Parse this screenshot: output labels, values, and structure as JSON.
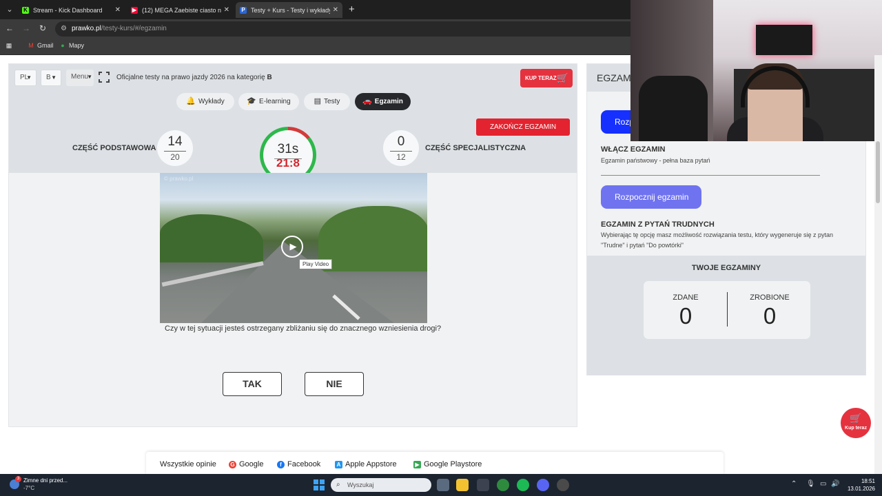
{
  "browser": {
    "tabs": [
      {
        "title": "Stream - Kick Dashboard",
        "favicon": "kick-icon",
        "active": false
      },
      {
        "title": "(12) MEGA Zaebiste ciasto na P",
        "favicon": "youtube-icon",
        "active": false
      },
      {
        "title": "Testy + Kurs - Testy i wykłady n",
        "favicon": "prawko-icon",
        "active": true
      }
    ],
    "url_host": "prawko.pl",
    "url_path": "/testy-kurs/#/egzamin",
    "bookmarks": [
      {
        "label": "Gmail",
        "icon": "gmail-icon"
      },
      {
        "label": "Mapy",
        "icon": "maps-icon"
      }
    ]
  },
  "header": {
    "lang": "PL",
    "category": "B",
    "menu": "Menu",
    "official_prefix": "Oficjalne testy na prawo jazdy 2026 na kategorię",
    "official_category": "B",
    "buy_label": "KUP TERAZ"
  },
  "nav": {
    "items": [
      {
        "label": "Wykłady",
        "icon": "bell-icon"
      },
      {
        "label": "E-learning",
        "icon": "graduation-cap-icon"
      },
      {
        "label": "Testy",
        "icon": "document-icon"
      },
      {
        "label": "Egzamin",
        "icon": "car-icon"
      }
    ],
    "active": "Egzamin"
  },
  "exam": {
    "end_label": "ZAKOŃCZ EGZAMIN",
    "basic_label": "CZĘŚĆ PODSTAWOWA",
    "basic_current": "14",
    "basic_total": "20",
    "special_label": "CZĘŚĆ SPECJALISTYCZNA",
    "special_current": "0",
    "special_total": "12",
    "timer_seconds": "31s",
    "timer_clock": "21:8",
    "timer_progress": 0.86,
    "video_watermark": "© prawko.pl",
    "play_tooltip": "Play Video",
    "question": "Czy w tej sytuacji jesteś ostrzegany zbliżaniu się do znacznego wzniesienia drogi?",
    "answer_yes": "TAK",
    "answer_no": "NIE"
  },
  "sidebar": {
    "title": "EGZAMIN",
    "start_button_partial": "Rozp",
    "enable_title": "WŁĄCZ EGZAMIN",
    "enable_sub": "Egzamin państwowy - pełna baza pytań",
    "start_button": "Rozpocznij egzamin",
    "hard_title": "EGZAMIN Z PYTAŃ TRUDNYCH",
    "hard_sub": "Wybierając tę opcję masz możliwość rozwiązania testu, który wygeneruje się z pytan \"Trudne\" i pytań \"Do powtórki\"",
    "stats_title": "TWOJE EGZAMINY",
    "passed_label": "ZDANE",
    "passed_value": "0",
    "done_label": "ZROBIONE",
    "done_value": "0"
  },
  "fab": {
    "label": "Kup teraz"
  },
  "reviews": [
    {
      "label": "Wszystkie opinie",
      "icon": ""
    },
    {
      "label": "Google",
      "icon": "google-icon"
    },
    {
      "label": "Facebook",
      "icon": "facebook-icon"
    },
    {
      "label": "Apple Appstore",
      "icon": "appstore-icon"
    },
    {
      "label": "Google Playstore",
      "icon": "playstore-icon"
    }
  ],
  "taskbar": {
    "weather_title": "Zimne dni przed...",
    "weather_temp": "-7°C",
    "weather_badge": "3",
    "search_placeholder": "Wyszukaj",
    "time": "18:51",
    "date": "13.01.2026"
  },
  "colors": {
    "accent_red": "#e3232f",
    "button_blue": "#1530ff",
    "button_violet": "#6f73f0",
    "timer_green": "#2db84b",
    "nav_active": "#26282b"
  }
}
